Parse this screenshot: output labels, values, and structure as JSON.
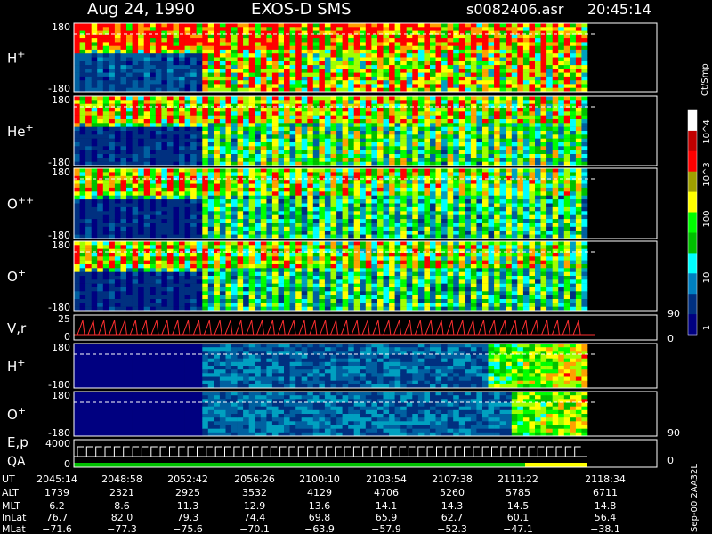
{
  "header": {
    "date": "Aug 24, 1990",
    "instrument": "EXOS-D SMS",
    "file": "s0082406.asr",
    "time": "20:45:14"
  },
  "colorbar": {
    "unit": "Ct/Smp",
    "tick_labels": [
      "10^4",
      "10^3",
      "100",
      "10",
      "1"
    ],
    "colors": [
      "#ffffff",
      "#c00000",
      "#ff0000",
      "#a0a000",
      "#ffff00",
      "#00ff00",
      "#00c000",
      "#00ffff",
      "#0080c0",
      "#003080",
      "#000080"
    ]
  },
  "footer_side_label": "Sep-00 2AA32L",
  "chart_data": {
    "type": "heatmap",
    "panels": [
      {
        "id": "h1",
        "species": "H",
        "charge": "+",
        "ylim": [
          -180,
          180
        ],
        "ticks": [
          "180",
          "-180"
        ],
        "variant": "h1"
      },
      {
        "id": "he1",
        "species": "He",
        "charge": "+",
        "ylim": [
          -180,
          180
        ],
        "ticks": [
          "180",
          "-180"
        ],
        "variant": "he"
      },
      {
        "id": "opp",
        "species": "O",
        "charge": "++",
        "ylim": [
          -180,
          180
        ],
        "ticks": [
          "180",
          "-180"
        ],
        "variant": "opp"
      },
      {
        "id": "o1",
        "species": "O",
        "charge": "+",
        "ylim": [
          -180,
          180
        ],
        "ticks": [
          "180",
          "-180"
        ],
        "variant": "o1"
      },
      {
        "id": "vr",
        "species": "V,r",
        "charge": "",
        "ylim": [
          0,
          25
        ],
        "ticks": [
          "25",
          "0"
        ],
        "right_ticks": [
          "90",
          "0"
        ],
        "variant": "line"
      },
      {
        "id": "h2",
        "species": "H",
        "charge": "+",
        "ylim": [
          -180,
          180
        ],
        "ticks": [
          "180",
          "-180"
        ],
        "variant": "h2"
      },
      {
        "id": "o2",
        "species": "O",
        "charge": "+",
        "ylim": [
          -180,
          180
        ],
        "ticks": [
          "180",
          "-180"
        ],
        "right_ticks": [
          "90"
        ],
        "variant": "o2"
      },
      {
        "id": "ep",
        "species": "E,p",
        "charge": "",
        "sublabel": "QA",
        "ylim": [
          0,
          4000
        ],
        "ticks": [
          "4000",
          "0"
        ],
        "right_ticks": [
          "0"
        ],
        "variant": "ep"
      }
    ],
    "table": {
      "row_labels": [
        "UT",
        "ALT",
        "MLT",
        "InLat",
        "MLat"
      ],
      "columns": [
        [
          "2045:14",
          "1739",
          "6.2",
          "76.7",
          "-71.6"
        ],
        [
          "2048:58",
          "2321",
          "8.6",
          "82.0",
          "-77.3"
        ],
        [
          "2052:42",
          "2925",
          "11.3",
          "79.3",
          "-75.6"
        ],
        [
          "2056:26",
          "3532",
          "12.9",
          "74.4",
          "-70.1"
        ],
        [
          "2100:10",
          "4129",
          "13.6",
          "69.8",
          "-63.9"
        ],
        [
          "2103:54",
          "4706",
          "14.1",
          "65.9",
          "-57.9"
        ],
        [
          "2107:38",
          "5260",
          "14.3",
          "62.7",
          "-52.3"
        ],
        [
          "2111:22",
          "5785",
          "14.5",
          "60.1",
          "-47.1"
        ],
        [
          "2118:34",
          "6711",
          "14.8",
          "56.4",
          "-38.1"
        ]
      ]
    }
  }
}
